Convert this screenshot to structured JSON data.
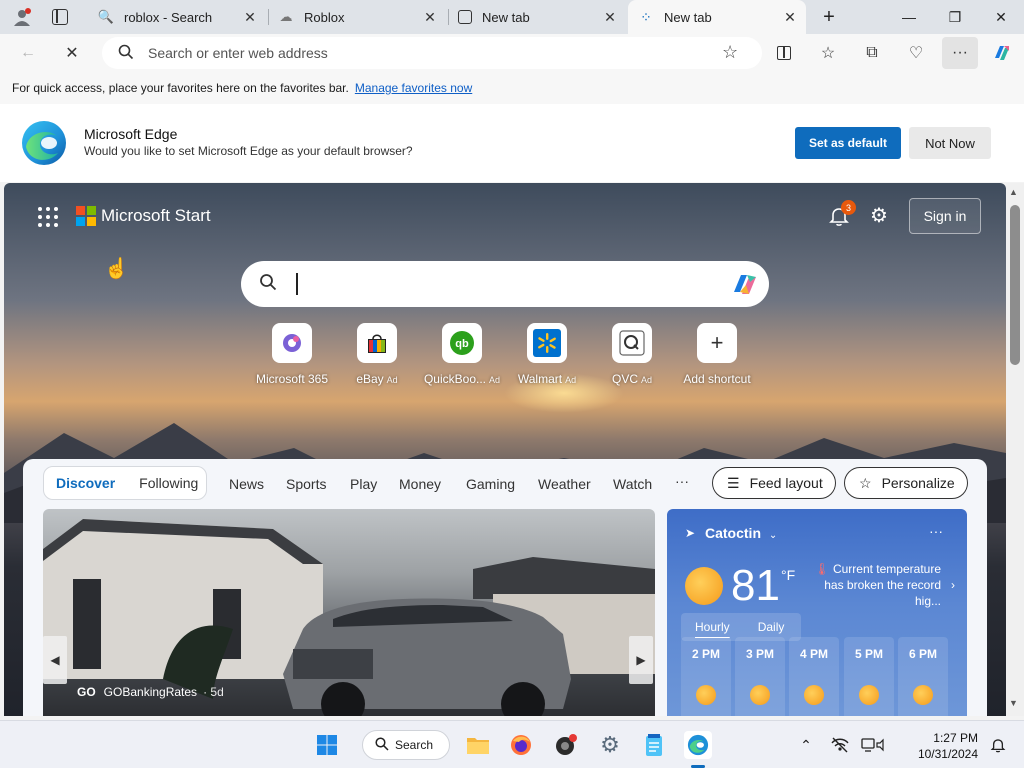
{
  "tabs": [
    {
      "title": "roblox - Search"
    },
    {
      "title": "Roblox"
    },
    {
      "title": "New tab"
    },
    {
      "title": "New tab"
    }
  ],
  "window": {
    "minimize": "—",
    "restore": "❐",
    "close": "✕",
    "new_tab": "+"
  },
  "toolbar": {
    "address_placeholder": "Search or enter web address"
  },
  "favorites_bar": {
    "text": "For quick access, place your favorites here on the favorites bar.",
    "link": "Manage favorites now"
  },
  "banner": {
    "title": "Microsoft Edge",
    "subtitle": "Would you like to set Microsoft Edge as your default browser?",
    "primary": "Set as default",
    "secondary": "Not Now"
  },
  "start": {
    "title": "Microsoft Start",
    "notification_count": "3",
    "signin": "Sign in",
    "shortcuts": [
      {
        "label": "Microsoft 365",
        "ad": ""
      },
      {
        "label": "eBay",
        "ad": "Ad"
      },
      {
        "label": "QuickBoo...",
        "ad": "Ad"
      },
      {
        "label": "Walmart",
        "ad": "Ad"
      },
      {
        "label": "QVC",
        "ad": "Ad"
      },
      {
        "label": "Add shortcut",
        "ad": ""
      }
    ]
  },
  "feed": {
    "discover": "Discover",
    "following": "Following",
    "nav": [
      "News",
      "Sports",
      "Play",
      "Money",
      "Gaming",
      "Weather",
      "Watch"
    ],
    "more": "···",
    "feed_layout": "Feed layout",
    "personalize": "Personalize",
    "hero": {
      "source_logo": "GO",
      "source": "GOBankingRates",
      "age": "· 5d"
    }
  },
  "weather": {
    "location": "Catoctin",
    "temperature": "81",
    "unit": "°F",
    "alert": "Current temperature has broken the record hig...",
    "tab_hourly": "Hourly",
    "tab_daily": "Daily",
    "hours": [
      "2 PM",
      "3 PM",
      "4 PM",
      "5 PM",
      "6 PM"
    ]
  },
  "taskbar": {
    "search": "Search",
    "time": "1:27 PM",
    "date": "10/31/2024"
  },
  "colors": {
    "accent": "#0f6cbd",
    "ms_red": "#f25022",
    "ms_green": "#7fba00",
    "ms_blue": "#00a4ef",
    "ms_yellow": "#ffb900"
  }
}
